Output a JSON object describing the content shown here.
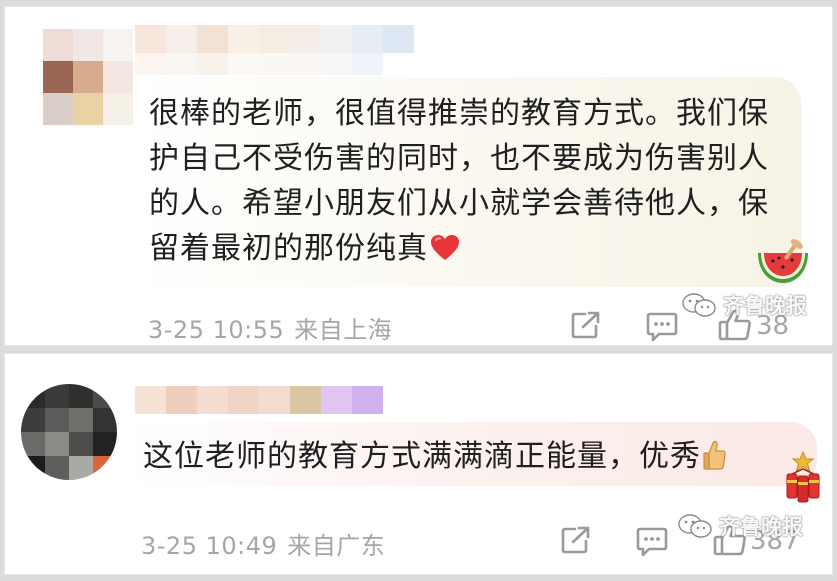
{
  "comments": [
    {
      "text": "很棒的老师，很值得推崇的教育方式。我们保护自己不受伤害的同时，也不要成为伤害别人的人。希望小朋友们从小就学会善待他人，保留着最初的那份纯真",
      "emoji_after": "heart-icon",
      "time": "3-25 10:55",
      "location": "来自上海",
      "likes": "38",
      "sticker": "watermelon-sticker"
    },
    {
      "text": "这位老师的教育方式满满滴正能量，优秀",
      "emoji_after": "thumbs-up-emoji",
      "time": "3-25 10:49",
      "location": "来自广东",
      "likes": "387",
      "sticker": "firecracker-sticker"
    }
  ],
  "watermark": {
    "text": "齐鲁晚报",
    "icon": "wechat-icon"
  },
  "colors": {
    "meta_text": "#a6a6a6",
    "body_text": "#1f1f1f",
    "heart": "#e8333b",
    "icon_stroke": "#9a9a9a"
  }
}
